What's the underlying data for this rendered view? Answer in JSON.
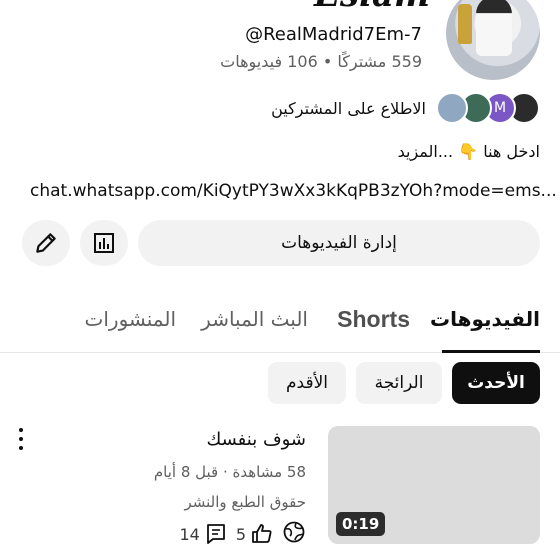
{
  "channel": {
    "name": "Esiam",
    "handle": "@RealMadrid7Em-7",
    "stats": "559 مشتركًا • 106 فيديوهات"
  },
  "subscribers": {
    "label": "الاطلاع على المشتركين",
    "avatars": [
      {
        "letter": "",
        "color": "#8fa7c0"
      },
      {
        "letter": "",
        "color": "#3d6b57"
      },
      {
        "letter": "M",
        "color": "#7b57c6"
      },
      {
        "letter": "",
        "color": "#2b2b2b"
      }
    ]
  },
  "description": {
    "text": "ادخل هنا 👇 ...المزيد",
    "link": "chat.whatsapp.com/KiQytPY3wXx3kKqPB3zYOh?mode=ems..."
  },
  "actions": {
    "manage_label": "إدارة الفيديوهات",
    "analytics_icon": "analytics-icon",
    "edit_icon": "pencil-icon"
  },
  "tabs": [
    {
      "label": "الفيديوهات",
      "active": true
    },
    {
      "label": "Shorts",
      "active": false
    },
    {
      "label": "البث المباشر",
      "active": false
    },
    {
      "label": "المنشورات",
      "active": false
    }
  ],
  "sort_chips": [
    {
      "label": "الأحدث",
      "active": true
    },
    {
      "label": "الرائجة",
      "active": false
    },
    {
      "label": "الأقدم",
      "active": false
    }
  ],
  "video": {
    "title": "شوف بنفسك",
    "meta": "58 مشاهدة · قبل 8 أيام",
    "license": "حقوق الطبع والنشر",
    "duration": "0:19",
    "likes": "5",
    "comments": "14",
    "visibility_icon": "globe-icon"
  },
  "colors": {
    "text": "#0f0f0f",
    "secondary": "#606060",
    "chip_bg": "#f2f2f2"
  }
}
